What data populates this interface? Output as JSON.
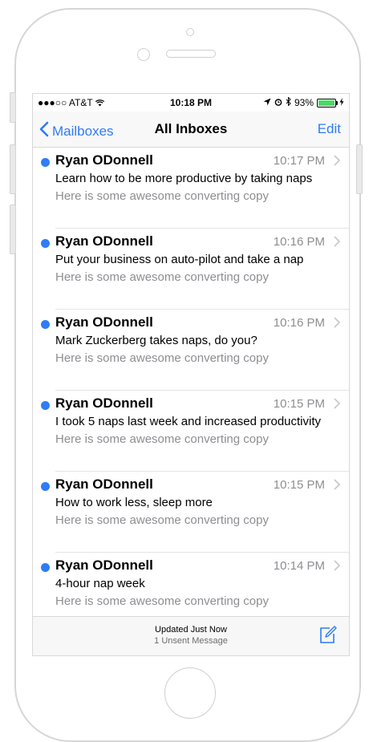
{
  "status_bar": {
    "carrier": "●●●○○ AT&T",
    "wifi_icon": "wifi-icon",
    "time": "10:18 PM",
    "battery": "93%",
    "battery_level": 0.93
  },
  "nav": {
    "back_label": "Mailboxes",
    "title": "All Inboxes",
    "edit_label": "Edit"
  },
  "messages": [
    {
      "sender": "Ryan ODonnell",
      "time": "10:17 PM",
      "subject": "Learn how to be more productive by taking naps",
      "preview": "Here is some awesome converting copy"
    },
    {
      "sender": "Ryan ODonnell",
      "time": "10:16 PM",
      "subject": "Put your business on auto-pilot and take a nap",
      "preview": "Here is some awesome converting copy"
    },
    {
      "sender": "Ryan ODonnell",
      "time": "10:16 PM",
      "subject": "Mark Zuckerberg takes naps, do you?",
      "preview": "Here is some awesome converting copy"
    },
    {
      "sender": "Ryan ODonnell",
      "time": "10:15 PM",
      "subject": "I took 5 naps last week and increased productivity",
      "preview": "Here is some awesome converting copy"
    },
    {
      "sender": "Ryan ODonnell",
      "time": "10:15 PM",
      "subject": "How to work less, sleep more",
      "preview": "Here is some awesome converting copy"
    },
    {
      "sender": "Ryan ODonnell",
      "time": "10:14 PM",
      "subject": "4-hour nap week",
      "preview": "Here is some awesome converting copy"
    }
  ],
  "toolbar": {
    "updated": "Updated Just Now",
    "unsent": "1 Unsent Message"
  },
  "colors": {
    "accent": "#2f7cf6",
    "unread_dot": "#2f7cf6",
    "battery_fill": "#4cd964"
  }
}
